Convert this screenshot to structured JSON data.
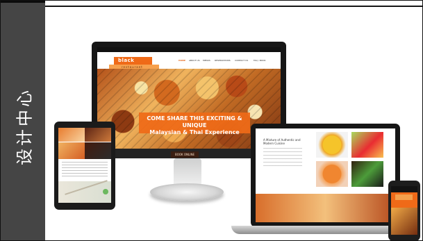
{
  "sidebar": {
    "label": "设计中心"
  },
  "devices": {
    "desktop": {
      "logo_top": "black pepper",
      "logo_bottom": "restaurant",
      "nav_items": [
        "HOME",
        "ABOUT US",
        "MENUS",
        "RESERVATIONS",
        "CONTACT US",
        "FAQ / BOOK"
      ],
      "hero_title": "COME SHARE THIS EXCITING & UNIQUE",
      "hero_subtitle": "Malaysian & Thai Experience",
      "cta_label": "BOOK ONLINE"
    },
    "laptop": {
      "heading": "A Mixture of Authentic and Modern Cuisine"
    }
  },
  "colors": {
    "brand_orange": "#ef6a18",
    "sidebar": "#454545"
  }
}
